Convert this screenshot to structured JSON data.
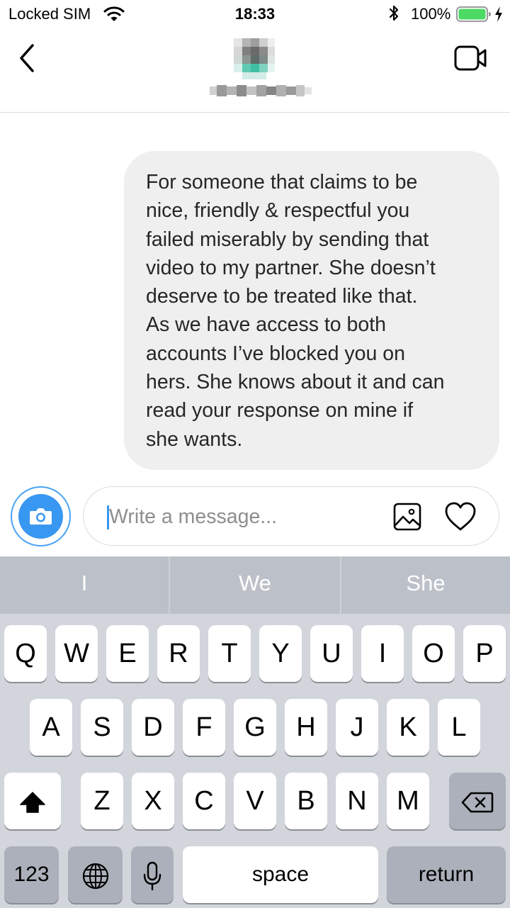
{
  "status_bar": {
    "carrier": "Locked SIM",
    "time": "18:33",
    "battery": "100%"
  },
  "header": {
    "back_icon": "chevron-left-icon",
    "video_icon": "video-camera-icon"
  },
  "conversation": {
    "messages": [
      {
        "direction": "outgoing",
        "text": "For someone that claims to be nice, friendly & respectful you failed miserably by sending that video to my partner. She doesn’t deserve to be treated like that. As we have access to both accounts I’ve blocked you on hers. She knows about it and can read your response on mine if she wants.",
        "lines": [
          "For someone that claims to be",
          "nice, friendly & respectful you",
          "failed miserably by sending that",
          "video to my partner. She doesn’t",
          "deserve to be treated like that.",
          "As we have access to both",
          "accounts I’ve blocked you on",
          "hers. She knows about it and can",
          "read your response on mine if",
          "she wants."
        ]
      }
    ]
  },
  "composer": {
    "placeholder": "Write a message...",
    "camera_icon": "camera-icon",
    "gallery_icon": "image-icon",
    "heart_icon": "heart-icon"
  },
  "keyboard": {
    "suggestions": [
      "I",
      "We",
      "She"
    ],
    "row1": [
      "Q",
      "W",
      "E",
      "R",
      "T",
      "Y",
      "U",
      "I",
      "O",
      "P"
    ],
    "row2": [
      "A",
      "S",
      "D",
      "F",
      "G",
      "H",
      "J",
      "K",
      "L"
    ],
    "row3": [
      "Z",
      "X",
      "C",
      "V",
      "B",
      "N",
      "M"
    ],
    "numbers_label": "123",
    "space_label": "space",
    "return_label": "return"
  },
  "colors": {
    "accent": "#3897f0",
    "bubble": "#efefef",
    "keyboard_bg": "#d2d5db",
    "suggestion_bar": "#bcc1c9",
    "battery": "#4cd964"
  }
}
